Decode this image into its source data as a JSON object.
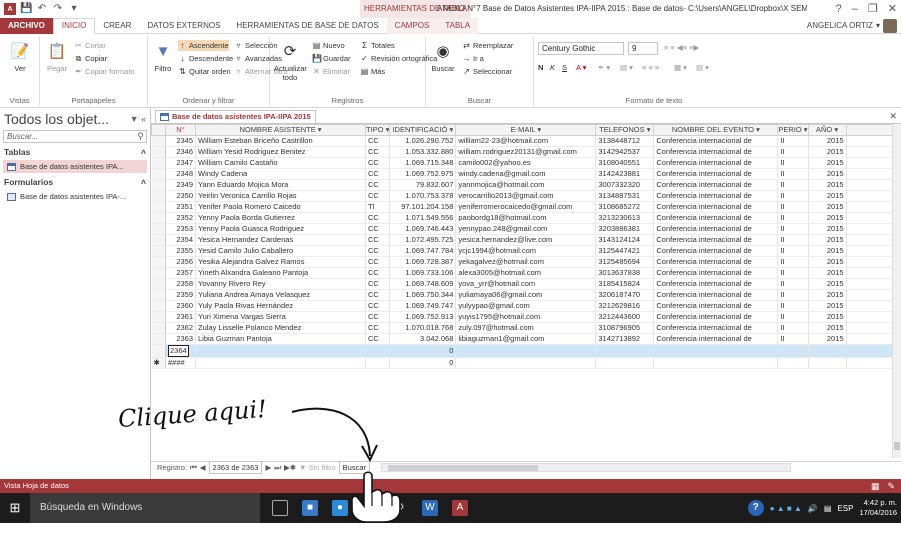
{
  "titlebar": {
    "app_icon": "A",
    "context_title": "HERRAMIENTAS DE TABLA",
    "window_title": "ANEXO N°7 Base de Datos Asistentes IPA-IIPA 2015 : Base de datos- C:\\Users\\ANGEL\\Dropbox\\X SEME...",
    "help": "?",
    "minimize": "–",
    "restore": "❐",
    "close": "✕"
  },
  "tabs": [
    {
      "label": "ARCHIVO",
      "kind": "file"
    },
    {
      "label": "INICIO",
      "kind": "active"
    },
    {
      "label": "CREAR",
      "kind": ""
    },
    {
      "label": "DATOS EXTERNOS",
      "kind": ""
    },
    {
      "label": "HERRAMIENTAS DE BASE DE DATOS",
      "kind": ""
    },
    {
      "label": "CAMPOS",
      "kind": "ctx"
    },
    {
      "label": "TABLA",
      "kind": "ctx"
    }
  ],
  "user": {
    "name": "ANGELICA ORTIZ"
  },
  "ribbon": {
    "views": {
      "ver": "Ver",
      "label": "Vistas"
    },
    "clipboard": {
      "pegar": "Pegar",
      "cortar": "Cortar",
      "copiar": "Copiar",
      "copiar_formato": "Copiar formato",
      "label": "Portapapeles"
    },
    "sort": {
      "filtro": "Filtro",
      "ascendente": "Ascendente",
      "descendente": "Descendente",
      "quitar_orden": "Quitar orden",
      "seleccion": "Selección",
      "avanzadas": "Avanzadas",
      "alternar_filtro": "Alternar filtro",
      "label": "Ordenar y filtrar"
    },
    "records": {
      "actualizar": "Actualizar todo",
      "nuevo": "Nuevo",
      "guardar": "Guardar",
      "eliminar": "Eliminar",
      "totales": "Totales",
      "revision": "Revisión ortográfica",
      "mas": "Más",
      "label": "Registros"
    },
    "find": {
      "buscar": "Buscar",
      "reemplazar": "Reemplazar",
      "ir_a": "Ir a",
      "seleccionar": "Seleccionar",
      "label": "Buscar"
    },
    "text": {
      "font": "Century Gothic",
      "size": "9",
      "bold": "N",
      "italic": "K",
      "underline": "S",
      "label": "Formato de texto"
    }
  },
  "nav": {
    "title": "Todos los objet...",
    "search_placeholder": "Buscar...",
    "sections": [
      {
        "name": "Tablas",
        "items": [
          "Base de datos asistentes IPA..."
        ]
      },
      {
        "name": "Formularios",
        "items": [
          "Base de datos asistentes IPA-..."
        ]
      }
    ]
  },
  "doc_tab": {
    "label": "Base de datos asistentes IPA-IIPA 2015"
  },
  "grid": {
    "columns": [
      "N°",
      "NOMBRE ASISTENTE",
      "TIPO",
      "IDENTIFICACIÓ",
      "E-MAIL",
      "TELEFONOS",
      "NOMBRE DEL EVENTO",
      "PERIO",
      "AÑO"
    ],
    "rows": [
      [
        "2345",
        "William Esteban Briceño Castrillon",
        "CC",
        "1.026.290.752",
        "william22-23@hotmail.com",
        "3138448712",
        "Conferencia internacional de",
        "II",
        "2015"
      ],
      [
        "2346",
        "William Yesid Rodriguez Benitez",
        "CC",
        "1.053.332.880",
        "william.rodriguez20131@gmail.com",
        "3142942537",
        "Conferencia internacional de",
        "II",
        "2015"
      ],
      [
        "2347",
        "William Camilo Castaño",
        "CC",
        "1.069.715.348",
        "camilo002@yahoo.es",
        "3108040551",
        "Conferencia internacional de",
        "II",
        "2015"
      ],
      [
        "2348",
        "Windy Cadena",
        "CC",
        "1.069.752.975",
        "windy.cadena@gmail.com",
        "3142423881",
        "Conferencia internacional de",
        "II",
        "2015"
      ],
      [
        "2349",
        "Yann Eduardo Mojica Mora",
        "CC",
        "79.832.607",
        "yannmojica@hotmail.com",
        "3007332320",
        "Conferencia internacional de",
        "II",
        "2015"
      ],
      [
        "2350",
        "Yeirlin Veronica Carrillo Rojas",
        "CC",
        "1.070.753.378",
        "verocarrillo2013@gmail.com",
        "3134887531",
        "Conferencia internacional de",
        "II",
        "2015"
      ],
      [
        "2351",
        "Yenifer Paola Romero Caicedo",
        "TI",
        "97.101.204.158",
        "yeniferromerocaicedo@gmail.com",
        "3108685272",
        "Conferencia internacional de",
        "II",
        "2015"
      ],
      [
        "2352",
        "Yenny Paola Borda Gutierrez",
        "CC",
        "1.071.549.556",
        "paobordg18@hotmail.com",
        "3213230613",
        "Conferencia internacional de",
        "II",
        "2015"
      ],
      [
        "2353",
        "Yenny Paola Guasca Rodriguez",
        "CC",
        "1.069.746.443",
        "yennypao.248@gmail.com",
        "3203886381",
        "Conferencia internacional de",
        "II",
        "2015"
      ],
      [
        "2354",
        "Yesica Hernandez Cardenas",
        "CC",
        "1.072.495.725",
        "yesica.hernandez@live.com",
        "3143124124",
        "Conferencia internacional de",
        "II",
        "2015"
      ],
      [
        "2355",
        "Yesid Camilo Julio Caballero",
        "CC",
        "1.069.747.784",
        "ycjc1994@hotmail.com",
        "3125447421",
        "Conferencia internacional de",
        "II",
        "2015"
      ],
      [
        "2356",
        "Yesika Alejandra Galvez Ramos",
        "CC",
        "1.069.728.387",
        "yekagalvez@hotmail.com",
        "3125485694",
        "Conferencia internacional de",
        "II",
        "2015"
      ],
      [
        "2357",
        "Yineth Alxandra Galeano Pantoja",
        "CC",
        "1.069.733.106",
        "alexa3005@hotmail.com",
        "3013637838",
        "Conferencia internacional de",
        "II",
        "2015"
      ],
      [
        "2358",
        "Yovanny Rivero Rey",
        "CC",
        "1.069.748.609",
        "yova_yrr@hotmail.com",
        "3185415824",
        "Conferencia internacional de",
        "II",
        "2015"
      ],
      [
        "2359",
        "Yuliana Andrea Amaya Velasquez",
        "CC",
        "1.069.750.344",
        "yuliamaya06@gmail.com",
        "3206187470",
        "Conferencia internacional de",
        "II",
        "2015"
      ],
      [
        "2360",
        "Yuly Paola Rivas Hernández",
        "CC",
        "1.069.749.747",
        "yulyypao@gmail.com",
        "3212629816",
        "Conferencia internacional de",
        "II",
        "2015"
      ],
      [
        "2361",
        "Yuri Ximena Vargas Sierra",
        "CC",
        "1.069.752.913",
        "yuyis1795@hotmail.com",
        "3212443600",
        "Conferencia internacional de",
        "II",
        "2015"
      ],
      [
        "2362",
        "Zulay Lisselle Polanco Mendez",
        "CC",
        "1.070.018.768",
        "zuly.097@hotmail.com",
        "3108796905",
        "Conferencia internacional de",
        "II",
        "2015"
      ],
      [
        "2363",
        "Libia Guzman Pantoja",
        "CC",
        "3.042.068",
        "libiaguzman1@gmail.com",
        "3142713892",
        "Conferencia internacional de",
        "II",
        "2015"
      ]
    ],
    "current_row": {
      "n": "2364",
      "ident": "0"
    },
    "new_row": {
      "marker": "✱",
      "n": "####",
      "ident": "0"
    }
  },
  "recnav": {
    "label": "Registro:",
    "position": "2363 de 2363",
    "no_filter": "Sin filtro",
    "search": "Buscar"
  },
  "status": {
    "text": "Vista Hoja de datos"
  },
  "taskbar": {
    "search_placeholder": "Búsqueda en Windows",
    "lang": "ESP",
    "time": "4:42 p. m.",
    "date": "17/04/2016"
  },
  "annotation": {
    "text": "Clique aqui!"
  },
  "colors": {
    "access_red": "#a4373a",
    "selection_blue": "#cfe6f7",
    "taskbar": "#1c1c1c"
  }
}
